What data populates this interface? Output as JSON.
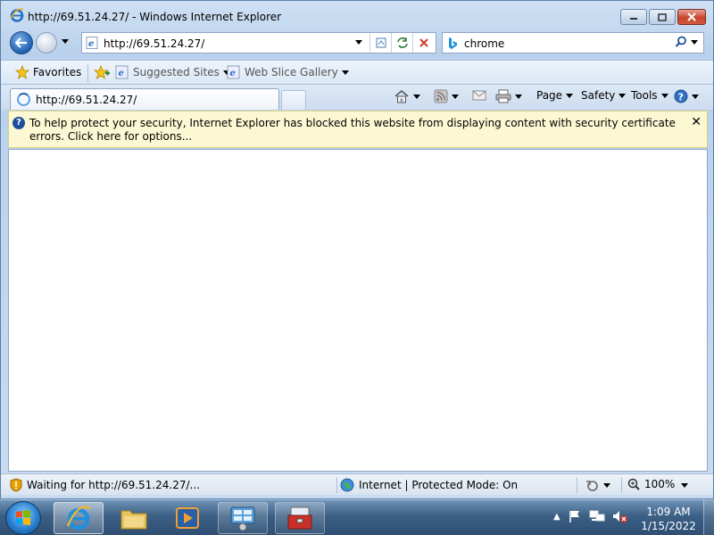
{
  "window": {
    "title": "http://69.51.24.27/ - Windows Internet Explorer"
  },
  "nav": {
    "address_value": "http://69.51.24.27/",
    "search_value": "chrome"
  },
  "favorites_bar": {
    "favorites_label": "Favorites",
    "suggested_sites_label": "Suggested Sites",
    "web_slice_gallery_label": "Web Slice Gallery"
  },
  "tabs": {
    "active_tab_label": "http://69.51.24.27/"
  },
  "command_bar": {
    "page_label": "Page",
    "safety_label": "Safety",
    "tools_label": "Tools"
  },
  "info_bar": {
    "message": "To help protect your security, Internet Explorer has blocked this website from displaying content with security certificate errors. Click here for options..."
  },
  "status_bar": {
    "status_text": "Waiting for http://69.51.24.27/...",
    "zone_text": "Internet | Protected Mode: On",
    "zoom_text": "100%"
  },
  "taskbar": {
    "clock_time": "1:09 AM",
    "clock_date": "1/15/2022"
  },
  "colors": {
    "info_bar_bg": "#fbf8d3",
    "close_button": "#c94530",
    "taskbar": "#3c5f85"
  }
}
